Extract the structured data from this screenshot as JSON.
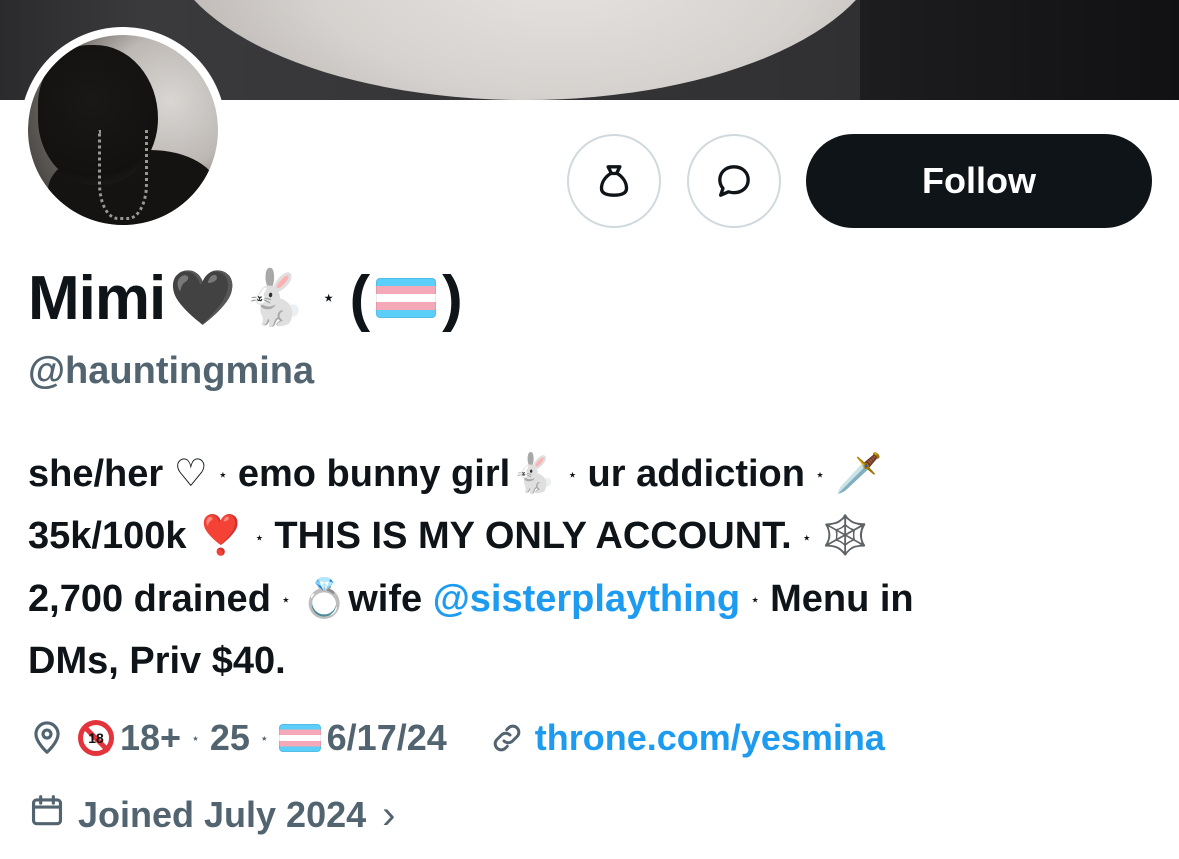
{
  "profile": {
    "name": "Mimi",
    "name_emoji_1": "🖤",
    "name_emoji_2": "🐇",
    "name_sep": "⋆",
    "name_paren_open": "(",
    "name_paren_close": ")",
    "handle": "@hauntingmina"
  },
  "actions": {
    "tip_icon": "money-bag-icon",
    "message_icon": "message-bubble-icon",
    "follow_label": "Follow"
  },
  "bio": {
    "line1": {
      "pronouns": "she/her",
      "heart": "♡",
      "sep": "⋆",
      "part2": "emo bunny girl",
      "rabbit": "🐇",
      "part3": "ur addiction",
      "dagger": "🗡️"
    },
    "line2": {
      "part1": "35k/100k",
      "heart": "❣️",
      "part2": "THIS IS MY ONLY ACCOUNT.",
      "web": "🕸️"
    },
    "line3": {
      "part1": "2,700 drained",
      "ring": "💍",
      "part2": "wife",
      "mention": "@sisterplaything",
      "part3": "Menu in"
    },
    "line4": {
      "part1": "DMs, Priv $40."
    }
  },
  "meta": {
    "location_icon": "location-pin-icon",
    "age_badge_text": "18",
    "age": "18+",
    "sep": "⋆",
    "years": "25",
    "flag": "trans-flag",
    "date": "6/17/24",
    "link_icon": "link-icon",
    "link": "throne.com/yesmina",
    "calendar_icon": "calendar-icon",
    "joined": "Joined July 2024",
    "chevron": "›"
  },
  "colors": {
    "accent": "#1d9bf0",
    "secondary_text": "#536471",
    "primary_text": "#0f1419",
    "border": "#cfd9de"
  }
}
